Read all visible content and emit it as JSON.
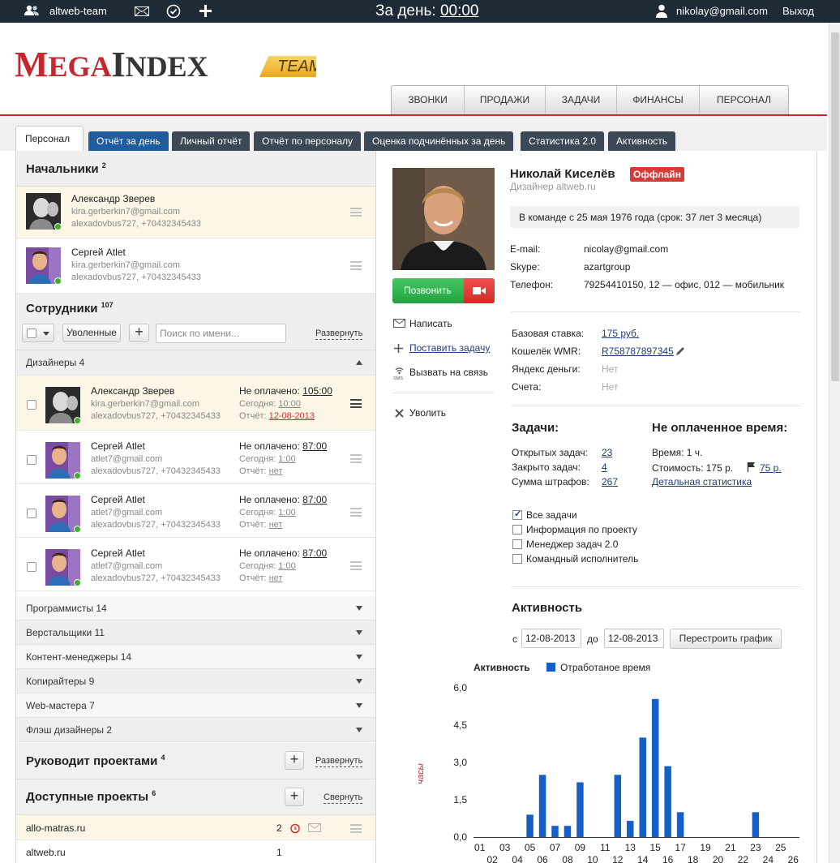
{
  "topbar": {
    "team": "altweb-team",
    "day_label": "За день:",
    "day_time": "00:00",
    "user_email": "nikolay@gmail.com",
    "logout": "Выход"
  },
  "logo": {
    "word": "MegaIndex",
    "badge": "TEAM"
  },
  "mainnav": [
    "ЗВОНКИ",
    "ПРОДАЖИ",
    "ЗАДАЧИ",
    "ФИНАНСЫ",
    "ПЕРСОНАЛ"
  ],
  "subtabs": [
    "Персонал",
    "Отчёт за день",
    "Личный отчёт",
    "Отчёт по персоналу",
    "Оценка подчинённых за день",
    "Статистика 2.0",
    "Активность"
  ],
  "bosses": {
    "title": "Начальники",
    "count": "2",
    "items": [
      {
        "name": "Александр Зверев",
        "email": "kira.gerberkin7@gmail.com",
        "contact": "alexadovbus727, +70432345433"
      },
      {
        "name": "Сергей Atlet",
        "email": "kira.gerberkin7@gmail.com",
        "contact": "alexadovbus727, +70432345433"
      }
    ]
  },
  "staff": {
    "title": "Сотрудники",
    "count": "107",
    "fired_btn": "Уволенные",
    "search_placeholder": "Поиск по имени...",
    "expand_link": "Развернуть",
    "group_title": "Дизайнеры 4",
    "unpaid_label": "Не оплачено:",
    "today_label": "Сегодня:",
    "report_label": "Отчёт:",
    "items": [
      {
        "name": "Александр Зверев",
        "email": "kira.gerberkin7@gmail.com",
        "contact": "alexadovbus727, +70432345433",
        "unpaid": "105:00",
        "today": "10:00",
        "report": "12-08-2013"
      },
      {
        "name": "Сергей Atlet",
        "email": "atlet7@gmail.com",
        "contact": "alexadovbus727, +70432345433",
        "unpaid": "87:00",
        "today": "1:00",
        "report": "нет"
      },
      {
        "name": "Сергей Atlet",
        "email": "atlet7@gmail.com",
        "contact": "alexadovbus727, +70432345433",
        "unpaid": "87:00",
        "today": "1:00",
        "report": "нет"
      },
      {
        "name": "Сергей Atlet",
        "email": "atlet7@gmail.com",
        "contact": "alexadovbus727, +70432345433",
        "unpaid": "87:00",
        "today": "1:00",
        "report": "нет"
      }
    ],
    "groups": [
      "Программисты 14",
      "Верстальщики 11",
      "Контент-менеджеры 14",
      "Копирайтеры 9",
      "Web-мастера 7",
      "Флэш дизайнеры 2"
    ]
  },
  "manages": {
    "title": "Руководит проектами",
    "count": "4",
    "link": "Развернуть"
  },
  "projects": {
    "title": "Доступные проекты",
    "count": "6",
    "link": "Свернуть",
    "items": [
      {
        "name": "allo-matras.ru",
        "count": "2"
      },
      {
        "name": "altweb.ru",
        "count": "1"
      }
    ]
  },
  "profile": {
    "name": "Николай Киселёв",
    "status": "Оффлайн",
    "role": "Дизайнер altweb.ru",
    "team_since": "В команде с 25 мая 1976 года (срок: 37 лет 3 месяца)",
    "call_btn": "Позвонить",
    "actions": [
      "Написать",
      "Поставить задачу",
      "Вызвать на связь",
      "Уволить"
    ],
    "contacts": [
      {
        "label": "E-mail:",
        "value": "nicolay@gmail.com"
      },
      {
        "label": "Skype:",
        "value": "azartgroup"
      },
      {
        "label": "Телефон:",
        "value": "79254410150, 12 — офис, 012 — мобильник"
      }
    ],
    "finance": [
      {
        "label": "Базовая ставка:",
        "value": "175 руб."
      },
      {
        "label": "Кошелёк WMR:",
        "value": "R758787897345"
      },
      {
        "label": "Яндекс деньги:",
        "value": "Нет"
      },
      {
        "label": "Счета:",
        "value": "Нет"
      }
    ]
  },
  "tasks": {
    "title": "Задачи:",
    "rows": [
      {
        "label": "Открытых задач:",
        "value": "23"
      },
      {
        "label": "Закрыто задач:",
        "value": "4"
      },
      {
        "label": "Сумма штрафов:",
        "value": "267"
      }
    ]
  },
  "unpaid_time": {
    "title": "Не оплаченное время:",
    "time": "Время: 1 ч.",
    "cost_label": "Стоимость: 175 р.",
    "cost_flag_value": "75 р.",
    "stats_link": "Детальная статистика"
  },
  "filters": [
    {
      "label": "Все задачи",
      "checked": true
    },
    {
      "label": "Информация по проекту",
      "checked": false
    },
    {
      "label": "Менеджер задач 2.0",
      "checked": false
    },
    {
      "label": "Командный исполнитель",
      "checked": false
    }
  ],
  "activity": {
    "title": "Активность",
    "from_label": "с",
    "from": "12-08-2013",
    "to_label": "до",
    "to": "12-08-2013",
    "rebuild_btn": "Перестроить график"
  },
  "chart_data": {
    "type": "bar",
    "title": "Активность",
    "series": [
      {
        "name": "Отработаное время",
        "values": [
          0,
          0,
          0,
          0,
          0.9,
          2.5,
          0.45,
          0.45,
          2.2,
          0,
          0,
          2.5,
          0.65,
          4.0,
          5.55,
          2.85,
          1.0,
          0,
          0,
          0,
          0,
          0,
          1.0,
          0,
          0,
          0
        ]
      }
    ],
    "categories": [
      "01",
      "02",
      "03",
      "04",
      "05",
      "06",
      "07",
      "08",
      "09",
      "10",
      "11",
      "12",
      "13",
      "14",
      "15",
      "16",
      "17",
      "18",
      "19",
      "20",
      "21",
      "22",
      "23",
      "24",
      "25",
      "26"
    ],
    "ylabel": "часы",
    "ylim": [
      0,
      6
    ],
    "yticks": [
      "0,0",
      "1,5",
      "3,0",
      "4,5",
      "6,0"
    ],
    "grid": false,
    "legend": "top",
    "color": "#1460c8"
  }
}
